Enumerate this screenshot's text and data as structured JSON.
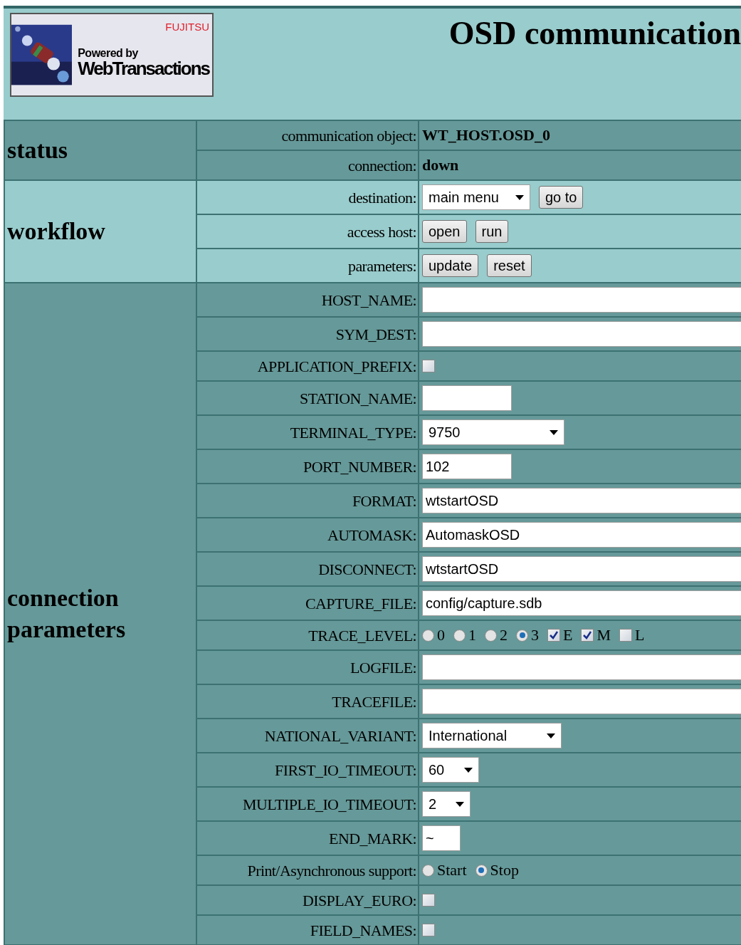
{
  "header": {
    "logo": {
      "brand": "FUJITSU",
      "tagline": "Powered by",
      "product": "WebTransactions"
    },
    "title": "OSD communication"
  },
  "sections": [
    {
      "title": "status",
      "rows": [
        {
          "label": "communication object:",
          "items": [
            {
              "kind": "info",
              "value": "WT_HOST.OSD_0"
            }
          ]
        },
        {
          "label": "connection:",
          "items": [
            {
              "kind": "info",
              "value": "down"
            }
          ]
        }
      ]
    },
    {
      "title": "workflow",
      "rows": [
        {
          "label": "destination:",
          "items": [
            {
              "kind": "select",
              "value": "main menu"
            },
            {
              "kind": "button",
              "label": "go to"
            }
          ]
        },
        {
          "label": "access host:",
          "items": [
            {
              "kind": "button",
              "label": "open"
            },
            {
              "kind": "button",
              "label": "run"
            }
          ]
        },
        {
          "label": "parameters:",
          "items": [
            {
              "kind": "button",
              "label": "update"
            },
            {
              "kind": "button",
              "label": "reset"
            }
          ]
        }
      ]
    },
    {
      "title": "connection parameters",
      "rows": [
        {
          "label": "HOST_NAME:",
          "items": [
            {
              "kind": "text"
            }
          ]
        },
        {
          "label": "SYM_DEST:",
          "items": [
            {
              "kind": "text"
            }
          ]
        },
        {
          "label": "APPLICATION_PREFIX:",
          "items": [
            {
              "kind": "checkbox",
              "checked": false
            }
          ]
        },
        {
          "label": "STATION_NAME:",
          "items": [
            {
              "kind": "text"
            }
          ]
        },
        {
          "label": "TERMINAL_TYPE:",
          "items": [
            {
              "kind": "select",
              "value": "9750"
            }
          ]
        },
        {
          "label": "PORT_NUMBER:",
          "items": [
            {
              "kind": "text",
              "value": "102"
            }
          ]
        },
        {
          "label": "FORMAT:",
          "items": [
            {
              "kind": "text",
              "value": "wtstartOSD"
            }
          ]
        },
        {
          "label": "AUTOMASK:",
          "items": [
            {
              "kind": "text",
              "value": "AutomaskOSD"
            }
          ]
        },
        {
          "label": "DISCONNECT:",
          "items": [
            {
              "kind": "text",
              "value": "wtstartOSD"
            }
          ]
        },
        {
          "label": "CAPTURE_FILE:",
          "items": [
            {
              "kind": "text",
              "value": "config/capture.sdb"
            }
          ]
        },
        {
          "label": "TRACE_LEVEL:",
          "items": [
            {
              "kind": "radio",
              "label": "0",
              "selected": false
            },
            {
              "kind": "radio",
              "label": "1",
              "selected": false
            },
            {
              "kind": "radio",
              "label": "2",
              "selected": false
            },
            {
              "kind": "radio",
              "label": "3",
              "selected": true
            },
            {
              "kind": "checkbox",
              "label": "E",
              "checked": true
            },
            {
              "kind": "checkbox",
              "label": "M",
              "checked": true
            },
            {
              "kind": "checkbox",
              "label": "L",
              "checked": false
            }
          ]
        },
        {
          "label": "LOGFILE:",
          "items": [
            {
              "kind": "text"
            }
          ]
        },
        {
          "label": "TRACEFILE:",
          "items": [
            {
              "kind": "text"
            }
          ]
        },
        {
          "label": "NATIONAL_VARIANT:",
          "items": [
            {
              "kind": "select",
              "value": "International"
            }
          ]
        },
        {
          "label": "FIRST_IO_TIMEOUT:",
          "items": [
            {
              "kind": "select",
              "value": "60"
            }
          ]
        },
        {
          "label": "MULTIPLE_IO_TIMEOUT:",
          "items": [
            {
              "kind": "select",
              "value": "2"
            }
          ]
        },
        {
          "label": "END_MARK:",
          "items": [
            {
              "kind": "text",
              "value": "~"
            }
          ]
        },
        {
          "label": "Print/Asynchronous support:",
          "items": [
            {
              "kind": "radio",
              "label": "Start",
              "selected": false
            },
            {
              "kind": "radio",
              "label": "Stop",
              "selected": true
            }
          ]
        },
        {
          "label": "DISPLAY_EURO:",
          "items": [
            {
              "kind": "checkbox",
              "checked": false
            }
          ]
        },
        {
          "label": "FIELD_NAMES:",
          "items": [
            {
              "kind": "checkbox",
              "checked": false
            }
          ]
        }
      ]
    }
  ]
}
